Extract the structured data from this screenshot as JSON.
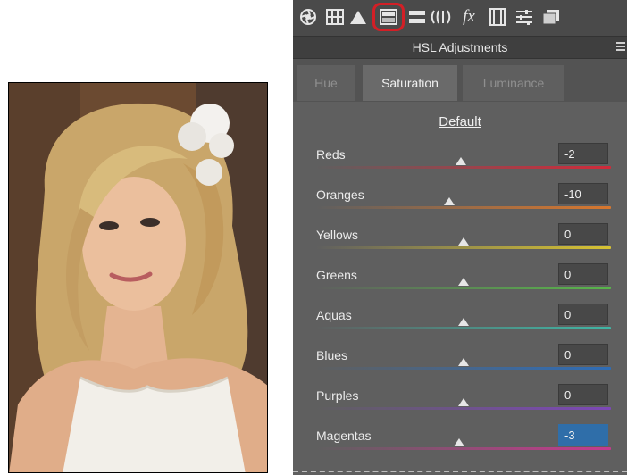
{
  "panel": {
    "title": "HSL Adjustments",
    "toolbar_icons": [
      "aperture-icon",
      "grid-icon",
      "mountain-icon",
      "hsl-icon",
      "split-tone-icon",
      "lens-icon",
      "fx-icon",
      "film-icon",
      "sliders-icon",
      "presets-icon"
    ],
    "tabs": [
      {
        "label": "Hue",
        "active": false
      },
      {
        "label": "Saturation",
        "active": true
      },
      {
        "label": "Luminance",
        "active": false
      }
    ],
    "default_label": "Default",
    "sliders": [
      {
        "label": "Reds",
        "value": "-2",
        "min": -100,
        "max": 100,
        "position": -2,
        "gradient": [
          "#5f5f5f",
          "#d12a3a"
        ]
      },
      {
        "label": "Oranges",
        "value": "-10",
        "min": -100,
        "max": 100,
        "position": -10,
        "gradient": [
          "#5f5f5f",
          "#d8772e"
        ]
      },
      {
        "label": "Yellows",
        "value": "0",
        "min": -100,
        "max": 100,
        "position": 0,
        "gradient": [
          "#5f5f5f",
          "#d8c332"
        ]
      },
      {
        "label": "Greens",
        "value": "0",
        "min": -100,
        "max": 100,
        "position": 0,
        "gradient": [
          "#5f5f5f",
          "#58b64a"
        ]
      },
      {
        "label": "Aquas",
        "value": "0",
        "min": -100,
        "max": 100,
        "position": 0,
        "gradient": [
          "#5f5f5f",
          "#3fb6a5"
        ]
      },
      {
        "label": "Blues",
        "value": "0",
        "min": -100,
        "max": 100,
        "position": 0,
        "gradient": [
          "#5f5f5f",
          "#2e6db8"
        ]
      },
      {
        "label": "Purples",
        "value": "0",
        "min": -100,
        "max": 100,
        "position": 0,
        "gradient": [
          "#5f5f5f",
          "#7d47b8"
        ]
      },
      {
        "label": "Magentas",
        "value": "-3",
        "min": -100,
        "max": 100,
        "position": -3,
        "gradient": [
          "#5f5f5f",
          "#c53a8e"
        ],
        "focused": true
      }
    ]
  },
  "colors": {
    "panel_bg": "#535353",
    "content_bg": "#5f5f5f",
    "highlight_ring": "#d31f26",
    "focus_blue": "#2f6ea9"
  }
}
